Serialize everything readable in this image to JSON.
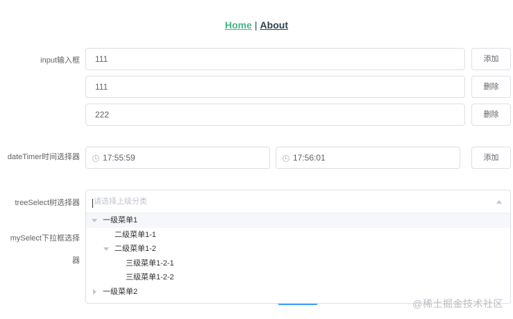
{
  "nav": {
    "home": "Home",
    "separator": "|",
    "about": "About"
  },
  "input_section": {
    "label": "input输入框",
    "rows": [
      {
        "value": "111",
        "button": "添加"
      },
      {
        "value": "111",
        "button": "删除"
      },
      {
        "value": "222",
        "button": "删除"
      }
    ]
  },
  "datetimer_section": {
    "label": "dateTimer时间选择器",
    "start_time": "17:55:59",
    "end_time": "17:56:01",
    "button": "添加"
  },
  "treeselect_section": {
    "label": "treeSelect树选择器",
    "placeholder": "请选择上级分类",
    "nodes": [
      {
        "label": "一级菜单1",
        "expanded": true
      },
      {
        "label": "二级菜单1-1"
      },
      {
        "label": "二级菜单1-2",
        "expanded": true
      },
      {
        "label": "三级菜单1-2-1"
      },
      {
        "label": "三级菜单1-2-2"
      },
      {
        "label": "一级菜单2",
        "expanded": false
      }
    ]
  },
  "myselect_section": {
    "label_line1": "mySelect下拉框选择",
    "label_line2": "器"
  },
  "watermark": "@稀土掘金技术社区",
  "colors": {
    "link_active": "#42b983",
    "link": "#2c3e50",
    "border": "#dcdfe6",
    "primary": "#409eff"
  }
}
